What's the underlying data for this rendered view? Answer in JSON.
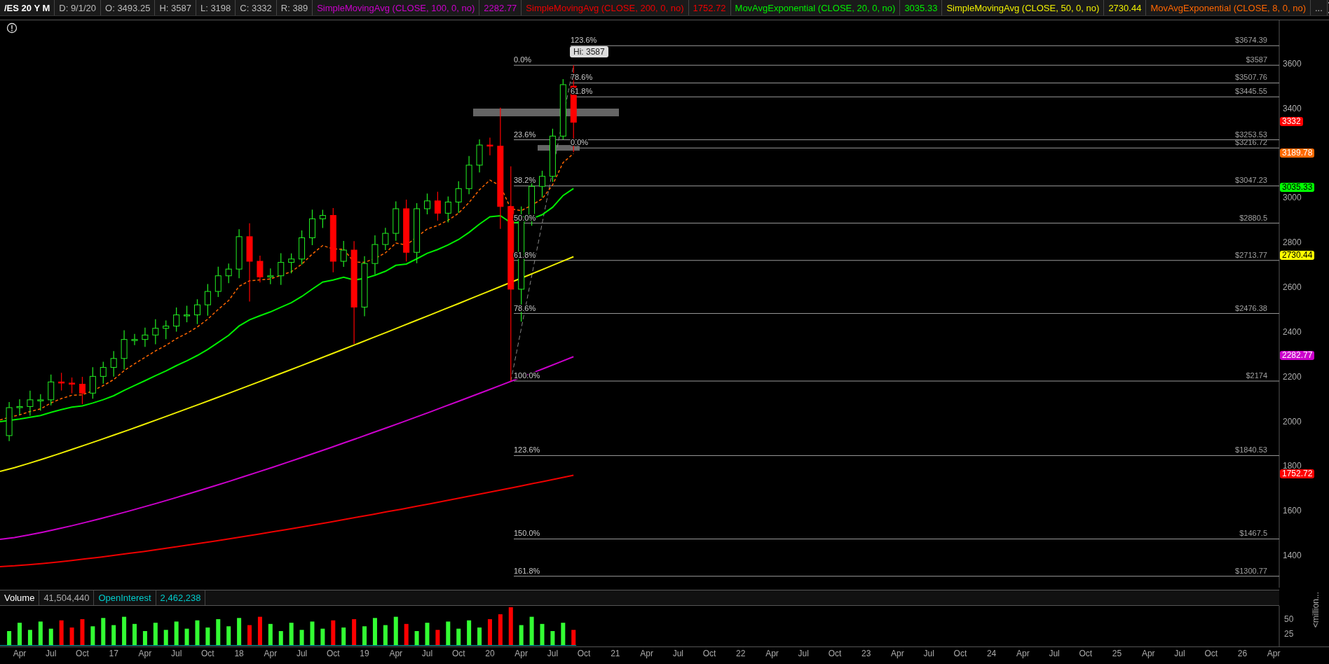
{
  "header": {
    "symbol": "/ES 20 Y M",
    "quote": [
      "D: 9/1/20",
      "O: 3493.25",
      "H: 3587",
      "L: 3198",
      "C: 3332",
      "R: 389"
    ],
    "studies": [
      {
        "name": "SimpleMovingAvg (CLOSE, 100, 0, no)",
        "value": "2282.77",
        "color": "#cc00cc"
      },
      {
        "name": "SimpleMovingAvg (CLOSE, 200, 0, no)",
        "value": "1752.72",
        "color": "#ee0000"
      },
      {
        "name": "MovAvgExponential (CLOSE, 20, 0, no)",
        "value": "3035.33",
        "color": "#00ee00"
      },
      {
        "name": "SimpleMovingAvg (CLOSE, 50, 0, no)",
        "value": "2730.44",
        "color": "#eeee00"
      },
      {
        "name": "MovAvgExponential (CLOSE, 8, 0, no)",
        "color": "#ff6600"
      }
    ],
    "more": "..."
  },
  "price_chart": {
    "high_bubble": "Hi: 3587",
    "fibonacci_sets": [
      {
        "levels": [
          {
            "percent": "0.0%",
            "price": "$3587"
          },
          {
            "percent": "23.6%",
            "price": "$3253.53"
          },
          {
            "percent": "38.2%",
            "price": "$3047.23"
          },
          {
            "percent": "50.0%",
            "price": "$2880.5"
          },
          {
            "percent": "61.8%",
            "price": "$2713.77"
          },
          {
            "percent": "78.6%",
            "price": "$2476.38"
          },
          {
            "percent": "100.0%",
            "price": "$2174"
          },
          {
            "percent": "123.6%",
            "price": "$1840.53"
          },
          {
            "percent": "150.0%",
            "price": "$1467.5"
          },
          {
            "percent": "161.8%",
            "price": "$1300.77"
          }
        ]
      },
      {
        "levels": [
          {
            "percent": "123.6%",
            "price": "$3674.39"
          },
          {
            "percent": "78.6%",
            "price": "$3507.76"
          },
          {
            "percent": "61.8%",
            "price": "$3445.55"
          },
          {
            "percent": "0.0%",
            "price": "$3216.72"
          }
        ]
      }
    ],
    "price_axis": {
      "ticks": [
        "3600",
        "3400",
        "3000",
        "2800",
        "2600",
        "2400",
        "2200",
        "2000",
        "1800",
        "1600",
        "1400"
      ],
      "badges": [
        {
          "text": "3332",
          "color": "#ff0000"
        },
        {
          "text": "3189.78",
          "color": "#ff6a00"
        },
        {
          "text": "3035.33",
          "color": "#00ff00"
        },
        {
          "text": "2730.44",
          "color": "#ffff00"
        },
        {
          "text": "2282.77",
          "color": "#cc00cc"
        },
        {
          "text": "1752.72",
          "color": "#ff0000"
        }
      ]
    }
  },
  "volume_panel": {
    "fields": [
      {
        "label": "Volume",
        "value": "41,504,440"
      },
      {
        "label": "OpenInterest",
        "value": "2,462,238"
      }
    ],
    "ticks": [
      "50",
      "25"
    ],
    "unit": "<million..."
  },
  "time_axis": {
    "labels": [
      "Apr",
      "Jul",
      "Oct",
      "17",
      "Apr",
      "Jul",
      "Oct",
      "18",
      "Apr",
      "Jul",
      "Oct",
      "19",
      "Apr",
      "Jul",
      "Oct",
      "20",
      "Apr",
      "Jul",
      "Oct",
      "21",
      "Apr",
      "Jul",
      "Oct",
      "22",
      "Apr",
      "Jul",
      "Oct",
      "23",
      "Apr",
      "Jul",
      "Oct",
      "24",
      "Apr",
      "Jul",
      "Oct",
      "25",
      "Apr",
      "Jul",
      "Oct",
      "26",
      "Apr"
    ]
  }
}
